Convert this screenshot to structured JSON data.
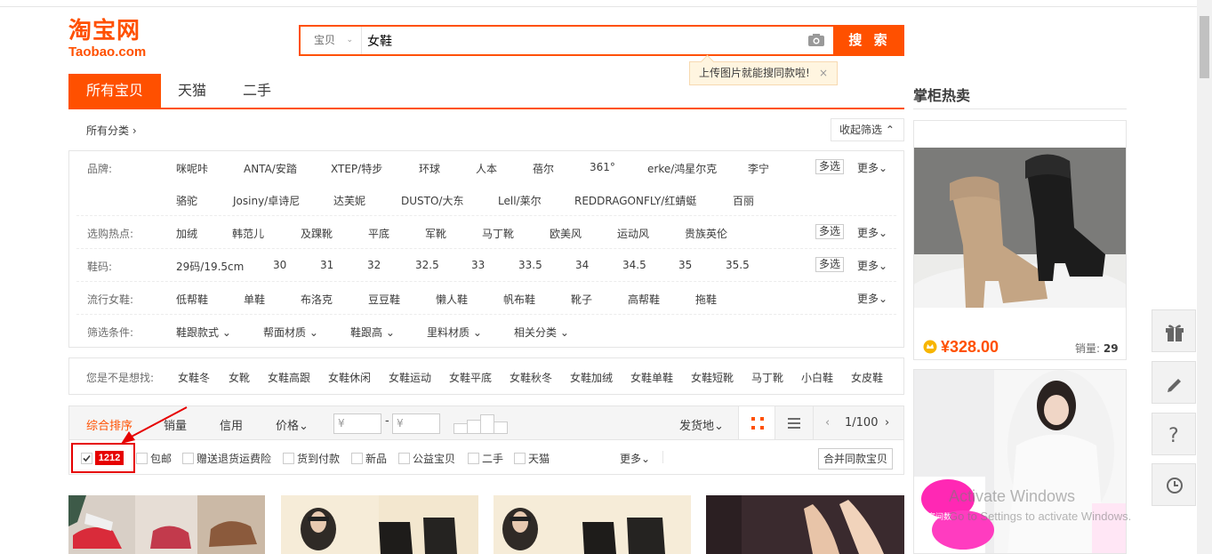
{
  "logo": {
    "cn": "淘宝网",
    "en": "Taobao.com"
  },
  "search": {
    "type_label": "宝贝",
    "query": "女鞋",
    "button": "搜 索",
    "tooltip": "上传图片就能搜同款啦!",
    "tooltip_close": "×"
  },
  "tabs": [
    {
      "label": "所有宝贝"
    },
    {
      "label": "天猫"
    },
    {
      "label": "二手"
    }
  ],
  "all_categories": "所有分类 ›",
  "collapse": "收起筛选 ⌃",
  "filters": {
    "brand": {
      "label": "品牌:",
      "items": [
        "咪呢咔",
        "ANTA/安踏",
        "XTEP/特步",
        "环球",
        "人本",
        "蓓尔",
        "361°",
        "erke/鸿星尔克",
        "李宁",
        "骆驼",
        "Josiny/卓诗尼",
        "达芙妮",
        "DUSTO/大东",
        "Lell/莱尔",
        "REDDRAGONFLY/红蜻蜓",
        "百丽"
      ]
    },
    "hot": {
      "label": "选购热点:",
      "items": [
        "加绒",
        "韩范儿",
        "及踝靴",
        "平底",
        "军靴",
        "马丁靴",
        "欧美风",
        "运动风",
        "贵族英伦"
      ]
    },
    "size": {
      "label": "鞋码:",
      "items": [
        "29码/19.5cm",
        "30",
        "31",
        "32",
        "32.5",
        "33",
        "33.5",
        "34",
        "34.5",
        "35",
        "35.5"
      ]
    },
    "popular": {
      "label": "流行女鞋:",
      "items": [
        "低帮鞋",
        "单鞋",
        "布洛克",
        "豆豆鞋",
        "懒人鞋",
        "帆布鞋",
        "靴子",
        "高帮鞋",
        "拖鞋"
      ]
    },
    "conditions": {
      "label": "筛选条件:",
      "items": [
        "鞋跟款式 ⌄",
        "帮面材质 ⌄",
        "鞋跟高 ⌄",
        "里料材质 ⌄",
        "相关分类 ⌄"
      ]
    },
    "multi": "多选",
    "more": "更多⌄"
  },
  "suggest": {
    "label": "您是不是想找:",
    "items": [
      "女鞋冬",
      "女靴",
      "女鞋高跟",
      "女鞋休闲",
      "女鞋运动",
      "女鞋平底",
      "女鞋秋冬",
      "女鞋加绒",
      "女鞋单鞋",
      "女鞋短靴",
      "马丁靴",
      "小白鞋",
      "女皮鞋"
    ]
  },
  "sortbar": {
    "default": "综合排序",
    "sales": "销量",
    "credit": "信用",
    "price": "价格⌄",
    "price_from": "¥",
    "price_dash": "-",
    "price_to": "¥",
    "location": "发货地⌄",
    "page": "1/100",
    "prev": "‹",
    "next": "›"
  },
  "options": {
    "badge": "1212",
    "items": [
      "包邮",
      "赠送退货运费险",
      "货到付款",
      "新品",
      "公益宝贝",
      "二手",
      "天猫"
    ],
    "more": "更多⌄",
    "merge": "合并同款宝贝"
  },
  "hot": {
    "title": "掌柜热卖",
    "price": "¥328.00",
    "sales_label": "销量:",
    "sales_value": "29"
  },
  "thumb2_text": "c家间数",
  "watermark": {
    "line1": "Activate Windows",
    "line2": "Go to Settings to activate Windows."
  },
  "colors": {
    "accent": "#ff5000",
    "highlight": "#e60000"
  }
}
